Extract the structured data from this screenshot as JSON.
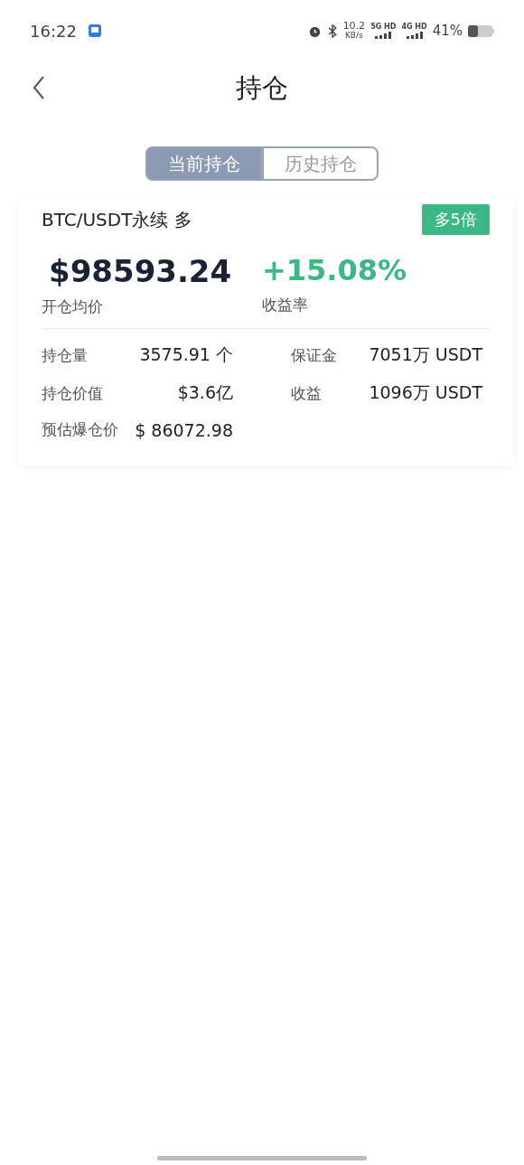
{
  "status_bar": {
    "time": "16:22",
    "speed": "10.2",
    "speed_unit": "KB/s",
    "networks": [
      "5G HD",
      "4G HD"
    ],
    "battery": "41%"
  },
  "header": {
    "title": "持仓"
  },
  "tabs": [
    {
      "label": "当前持仓",
      "selected": true
    },
    {
      "label": "历史持仓",
      "selected": false
    }
  ],
  "position": {
    "name": "BTC/USDT永续 多",
    "leverage": "多5倍",
    "price": "$98593.24",
    "price_label": "开仓均价",
    "yield": "+15.08%",
    "yield_label": "收益率",
    "stats": [
      {
        "label": "持仓量",
        "value": "3575.91 个"
      },
      {
        "label": "保证金",
        "value": "7051万 USDT"
      },
      {
        "label": "持仓价值",
        "value": "$3.6亿"
      },
      {
        "label": "收益",
        "value": "1096万 USDT"
      },
      {
        "label": "预估爆仓价",
        "value": "$ 86072.98"
      }
    ]
  }
}
